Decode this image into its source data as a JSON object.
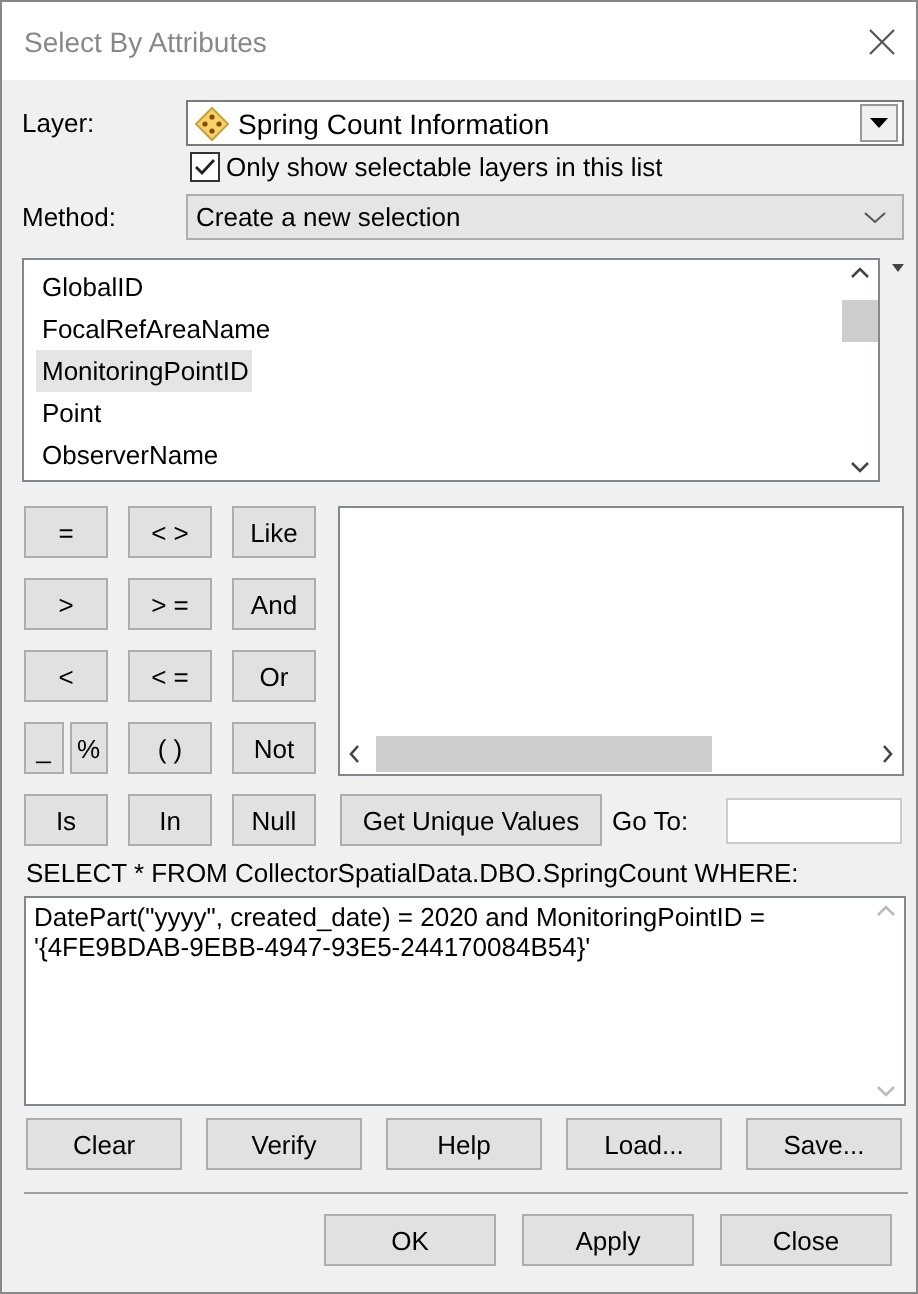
{
  "window": {
    "title": "Select By Attributes"
  },
  "layer": {
    "label": "Layer:",
    "value": "Spring Count Information"
  },
  "selectable_only": {
    "label": "Only show selectable layers in this list",
    "checked": true
  },
  "method": {
    "label": "Method:",
    "value": "Create a new selection"
  },
  "fields": [
    {
      "name": "GlobalID",
      "selected": false
    },
    {
      "name": "FocalRefAreaName",
      "selected": false
    },
    {
      "name": "MonitoringPointID",
      "selected": true
    },
    {
      "name": "Point",
      "selected": false
    },
    {
      "name": "ObserverName",
      "selected": false
    }
  ],
  "operators": [
    [
      "=",
      "< >",
      "Like"
    ],
    [
      ">",
      "> =",
      "And"
    ],
    [
      "<",
      "< =",
      "Or"
    ],
    [
      "_",
      "%",
      "( )",
      "Not"
    ],
    [
      "Is",
      "In",
      "Null"
    ]
  ],
  "get_unique_values": "Get Unique Values",
  "goto": {
    "label": "Go To:"
  },
  "query_label": "SELECT * FROM CollectorSpatialData.DBO.SpringCount WHERE:",
  "query": "DatePart(\"yyyy\", created_date) = 2020 and MonitoringPointID = '{4FE9BDAB-9EBB-4947-93E5-244170084B54}'",
  "actions": [
    "Clear",
    "Verify",
    "Help",
    "Load...",
    "Save..."
  ],
  "dialog_buttons": [
    "OK",
    "Apply",
    "Close"
  ]
}
